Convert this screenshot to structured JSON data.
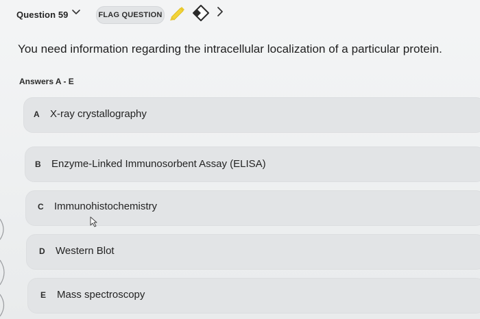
{
  "header": {
    "question_label": "Question 59",
    "flag_button_label": "FLAG QUESTION",
    "icons": [
      "chevron-down-icon",
      "pencil-icon",
      "eraser-icon",
      "chevron-right-icon"
    ]
  },
  "question": {
    "prompt": "You need information regarding the intracellular localization of a particular protein."
  },
  "answers": {
    "heading": "Answers A - E",
    "options": [
      {
        "letter": "A",
        "text": "X-ray crystallography"
      },
      {
        "letter": "B",
        "text": "Enzyme-Linked Immunosorbent Assay (ELISA)"
      },
      {
        "letter": "C",
        "text": "Immunohistochemistry"
      },
      {
        "letter": "D",
        "text": "Western Blot"
      },
      {
        "letter": "E",
        "text": "Mass spectroscopy"
      }
    ]
  },
  "colors": {
    "background": "#f1f2f3",
    "option_background": "#e2e4e6",
    "pencil_accent": "#f2d338"
  }
}
